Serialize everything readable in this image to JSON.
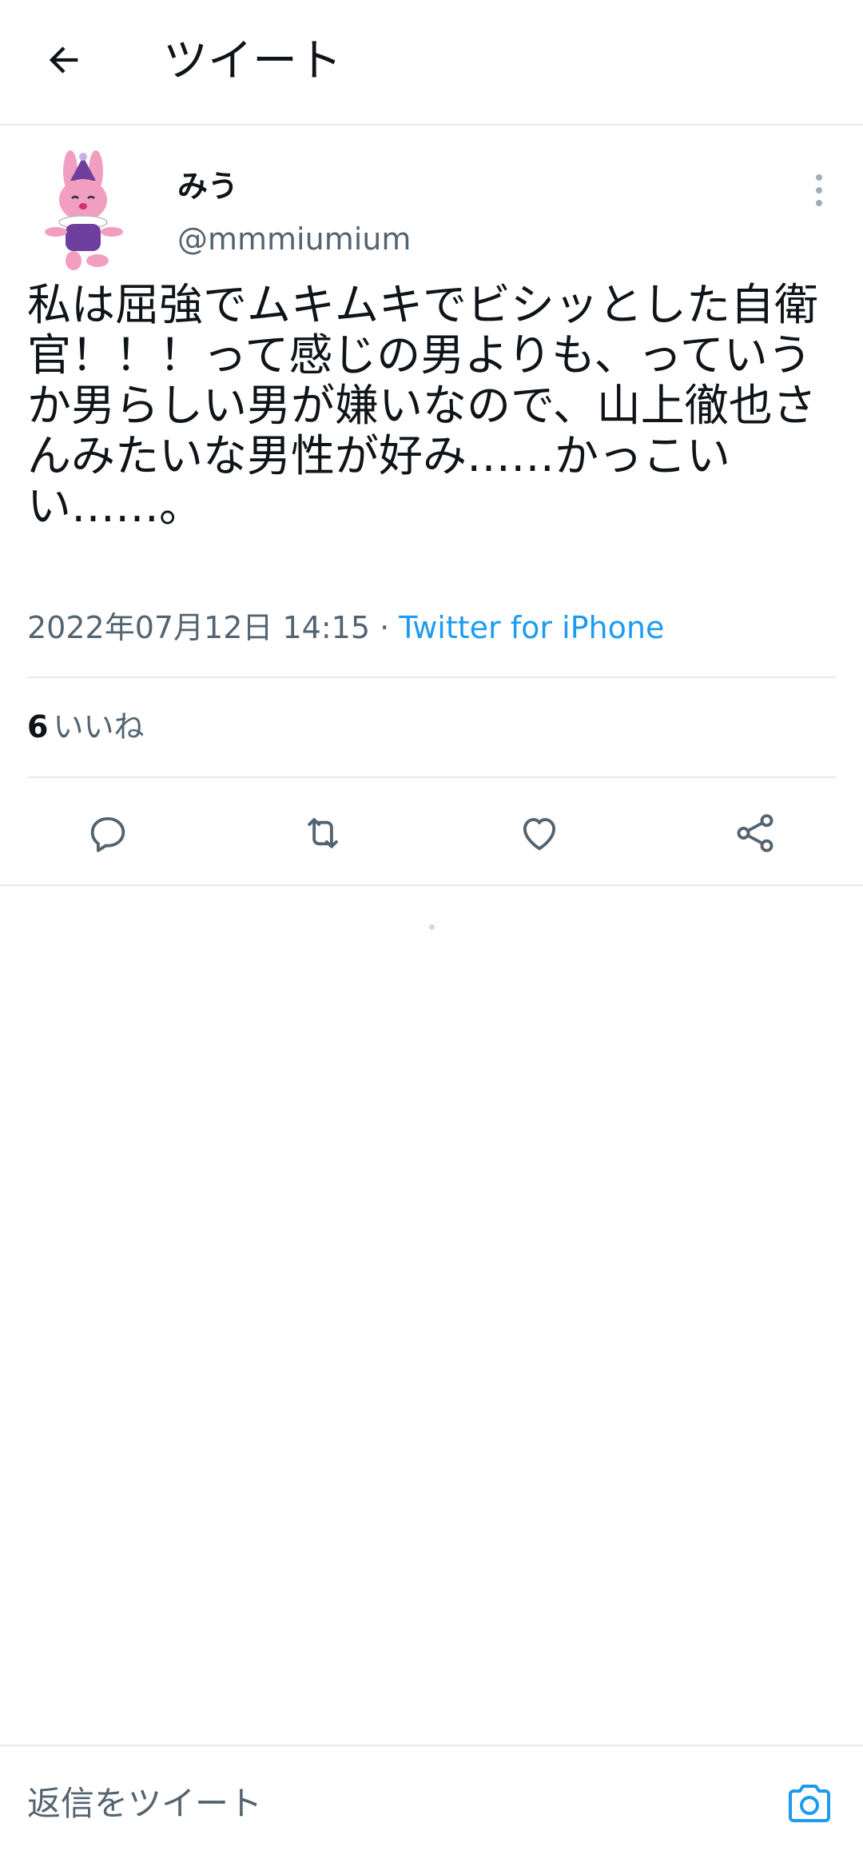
{
  "header": {
    "title": "ツイート",
    "back_icon": "arrow-left-icon"
  },
  "author": {
    "name": "みう",
    "handle": "@mmmiumium",
    "avatar_icon": "pink-rabbit-avatar",
    "more_icon": "more-vertical-icon"
  },
  "tweet": {
    "text": "私は屈強でムキムキでビシッとした自衛官！！！って感じの男よりも、っていうか男らしい男が嫌いなので、山上徹也さんみたいな男性が好み……かっこいい……。",
    "timestamp": "2022年07月12日 14:15",
    "separator": "·",
    "source": "Twitter for iPhone"
  },
  "stats": {
    "likes_count": "6",
    "likes_label": "いいね"
  },
  "actions": {
    "reply_icon": "reply-icon",
    "retweet_icon": "retweet-icon",
    "like_icon": "heart-icon",
    "share_icon": "share-icon"
  },
  "reply_bar": {
    "placeholder": "返信をツイート",
    "camera_icon": "camera-icon"
  },
  "colors": {
    "accent": "#1d9bf0",
    "secondary_text": "#536471",
    "divider": "#e6e9eb"
  }
}
